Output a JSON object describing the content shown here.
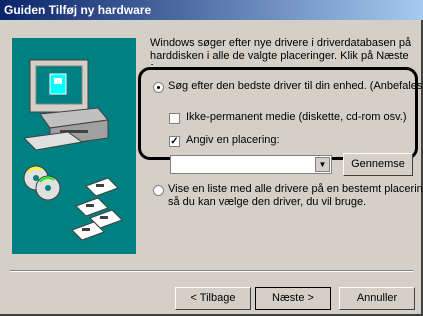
{
  "window": {
    "title": "Guiden Tilføj ny hardware"
  },
  "instructions": "Windows søger efter nye drivere i driverdatabasen på harddisken i alle de valgte placeringer. Klik på Næste for",
  "options": {
    "search_best": {
      "label": "Søg efter den bedste driver til din enhed. (Anbefales).",
      "selected": true
    },
    "removable_media": {
      "label": "Ikke-permanent medie (diskette, cd-rom osv.)",
      "checked": false
    },
    "specify_location": {
      "label": "Angiv en placering:",
      "checked": true
    },
    "location_value": "",
    "browse_label": "Gennemse",
    "show_list": {
      "label_line1": "Vise en liste med alle drivere på en bestemt placering,",
      "label_line2": "så du kan vælge den driver, du vil bruge.",
      "selected": false
    }
  },
  "buttons": {
    "back": "< Tilbage",
    "next": "Næste >",
    "cancel": "Annuller"
  },
  "colors": {
    "titlebar_start": "#0a246a",
    "titlebar_end": "#a6caf0",
    "illustration_bg": "#008080",
    "window_bg": "#d4d0c8"
  }
}
